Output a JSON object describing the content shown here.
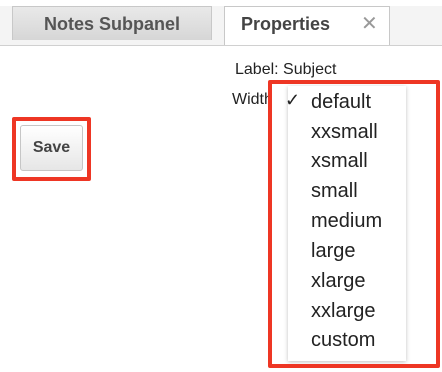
{
  "tabs": [
    {
      "label": "Notes Subpanel"
    },
    {
      "label": "Properties",
      "close_icon": "close-icon"
    }
  ],
  "properties": {
    "label_field": "Label: Subject",
    "width_field_partial": "Width"
  },
  "save_label": "Save",
  "width_dropdown": {
    "selected": "default",
    "selected_indicator": "✓",
    "options": [
      "default",
      "xxsmall",
      "xsmall",
      "small",
      "medium",
      "large",
      "xlarge",
      "xxlarge",
      "custom"
    ]
  },
  "colors": {
    "highlight": "#ee3624"
  }
}
